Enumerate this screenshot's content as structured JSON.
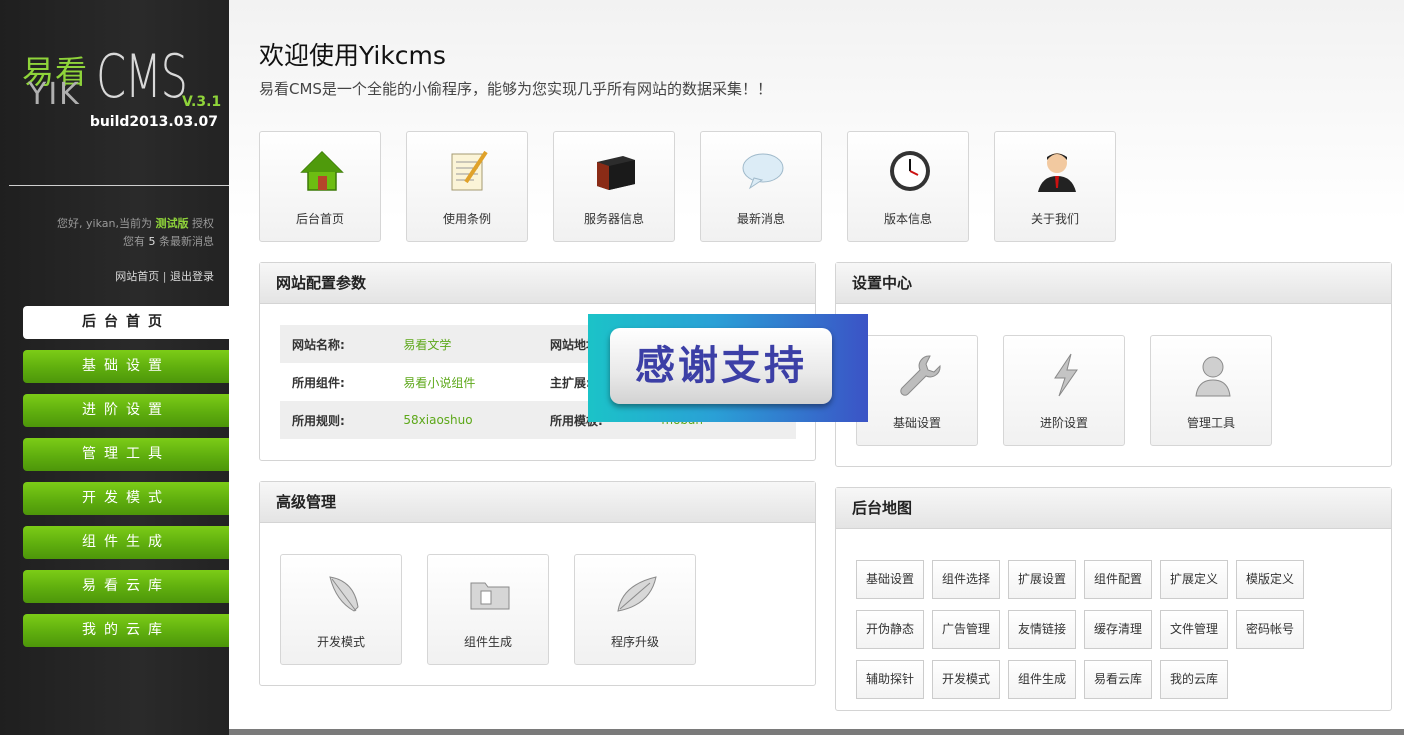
{
  "sidebar": {
    "logo_cn": "易看",
    "logo_yik": "YIK",
    "logo_cms": "CMS",
    "version": "V.3.1",
    "build": "build2013.03.07",
    "welcome_prefix": "您好, yikan,当前为",
    "version_label": "测试版",
    "welcome_suffix": "授权",
    "msg_prefix": "您有",
    "msg_count": "5",
    "msg_suffix": "条最新消息",
    "link_home": "网站首页",
    "link_sep": "|",
    "link_logout": "退出登录",
    "nav": [
      {
        "label": "后台首页",
        "active": true
      },
      {
        "label": "基础设置"
      },
      {
        "label": "进阶设置"
      },
      {
        "label": "管理工具"
      },
      {
        "label": "开发模式"
      },
      {
        "label": "组件生成"
      },
      {
        "label": "易看云库"
      },
      {
        "label": "我的云库"
      }
    ]
  },
  "header": {
    "title": "欢迎使用Yikcms",
    "subtitle": "易看CMS是一个全能的小偷程序，能够为您实现几乎所有网站的数据采集！！"
  },
  "top_tiles": [
    {
      "label": "后台首页",
      "icon": "home-icon"
    },
    {
      "label": "使用条例",
      "icon": "notepad-icon"
    },
    {
      "label": "服务器信息",
      "icon": "server-icon"
    },
    {
      "label": "最新消息",
      "icon": "speech-bubble-icon"
    },
    {
      "label": "版本信息",
      "icon": "clock-icon"
    },
    {
      "label": "关于我们",
      "icon": "user-icon"
    }
  ],
  "config_panel": {
    "title": "网站配置参数",
    "rows": [
      {
        "k1": "网站名称:",
        "v1": "易看文学",
        "k2": "网站地址:",
        "v2": ""
      },
      {
        "k1": "所用组件:",
        "v1": "易看小说组件",
        "k2": "主扩展:",
        "v2": ""
      },
      {
        "k1": "所用规则:",
        "v1": "58xiaoshuo",
        "k2": "所用模板:",
        "v2": "moban"
      }
    ]
  },
  "settings_panel": {
    "title": "设置中心",
    "tiles": [
      {
        "label": "基础设置",
        "icon": "wrench-icon"
      },
      {
        "label": "进阶设置",
        "icon": "lightning-icon"
      },
      {
        "label": "管理工具",
        "icon": "person-icon"
      }
    ]
  },
  "advanced_panel": {
    "title": "高级管理",
    "tiles": [
      {
        "label": "开发模式",
        "icon": "feather-icon"
      },
      {
        "label": "组件生成",
        "icon": "folder-icon"
      },
      {
        "label": "程序升级",
        "icon": "leaf-icon"
      }
    ]
  },
  "map_panel": {
    "title": "后台地图",
    "tags": [
      "基础设置",
      "组件选择",
      "扩展设置",
      "组件配置",
      "扩展定义",
      "模版定义",
      "开伪静态",
      "广告管理",
      "友情链接",
      "缓存清理",
      "文件管理",
      "密码帐号",
      "辅助探针",
      "开发模式",
      "组件生成",
      "易看云库",
      "我的云库"
    ]
  },
  "watermark": {
    "text": "感谢支持"
  },
  "colors": {
    "accent_green": "#6dbd12",
    "value_green": "#5da81a",
    "sidebar_bg": "#252525"
  }
}
